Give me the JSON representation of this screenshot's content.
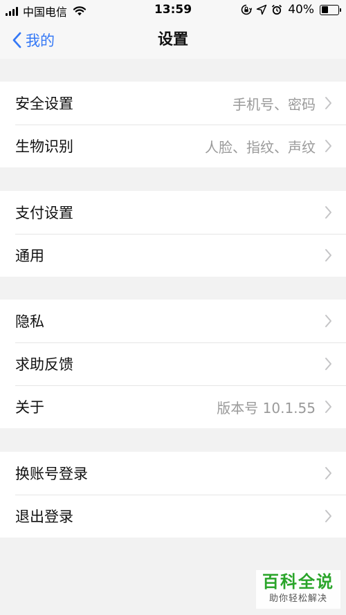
{
  "status_bar": {
    "carrier": "中国电信",
    "time": "13:59",
    "battery_percent_text": "40%",
    "battery_level": 0.4,
    "icons": [
      "signal-icon",
      "wifi-icon",
      "orientation-lock-icon",
      "location-icon",
      "alarm-icon",
      "battery-icon"
    ]
  },
  "nav": {
    "back_label": "我的",
    "title": "设置"
  },
  "groups": [
    {
      "rows": [
        {
          "label": "安全设置",
          "value": "手机号、密码"
        },
        {
          "label": "生物识别",
          "value": "人脸、指纹、声纹"
        }
      ]
    },
    {
      "rows": [
        {
          "label": "支付设置",
          "value": ""
        },
        {
          "label": "通用",
          "value": ""
        }
      ]
    },
    {
      "rows": [
        {
          "label": "隐私",
          "value": ""
        },
        {
          "label": "求助反馈",
          "value": ""
        },
        {
          "label": "关于",
          "value": "版本号 10.1.55"
        }
      ]
    },
    {
      "rows": [
        {
          "label": "换账号登录",
          "value": ""
        },
        {
          "label": "退出登录",
          "value": ""
        }
      ]
    }
  ],
  "watermark": {
    "title": "百科全说",
    "subtitle": "助你轻松解决"
  },
  "colors": {
    "accent": "#3478f6",
    "background": "#f2f2f2",
    "secondary_text": "#9a9a9a",
    "watermark_green": "#2aa52a"
  }
}
